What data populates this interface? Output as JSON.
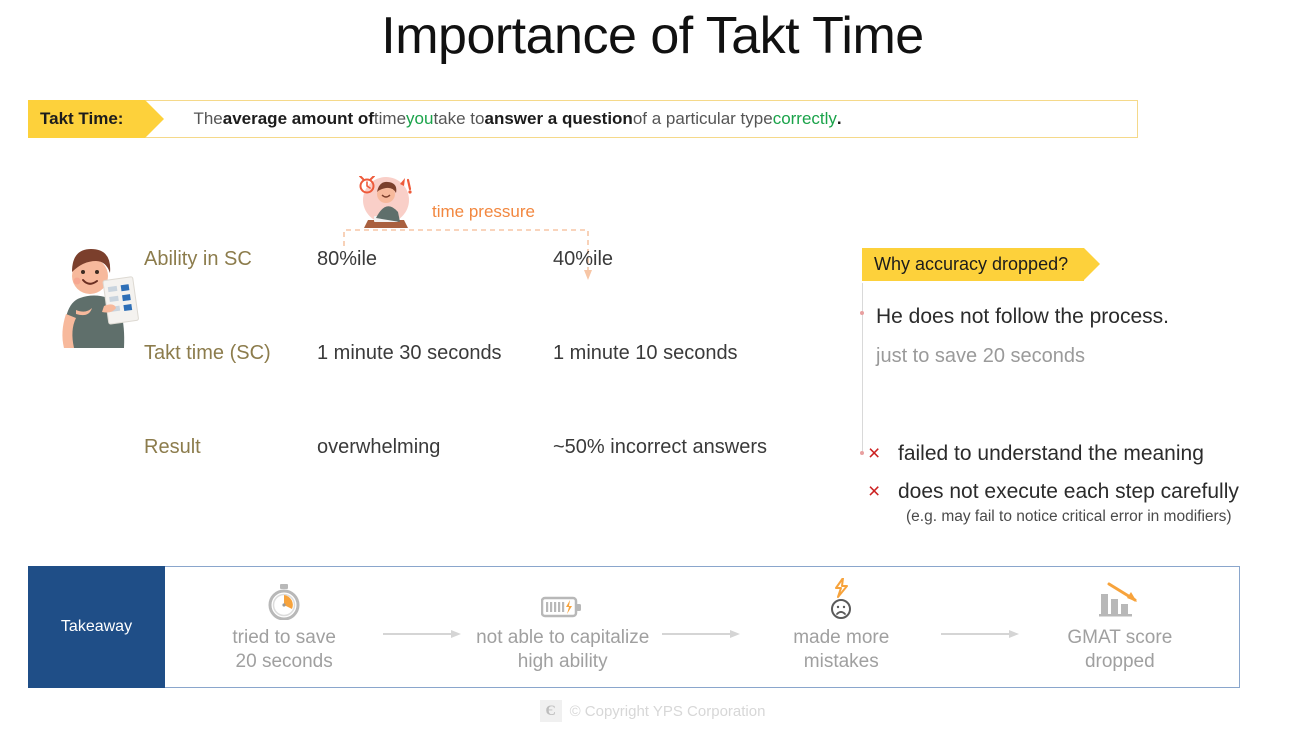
{
  "title": "Importance of Takt Time",
  "definition": {
    "tag": "Takt Time:",
    "seg1": "The ",
    "seg2_bold": "average amount of",
    "seg3": " time ",
    "seg4_green": "you",
    "seg5": " take to ",
    "seg6_bold": "answer a question",
    "seg7": " of a particular type ",
    "seg8_green": "correctly",
    "seg9": "."
  },
  "time_pressure": {
    "label": "time pressure"
  },
  "comparison": {
    "rows": [
      {
        "label": "Ability in SC",
        "col1": "80%ile",
        "col2": "40%ile"
      },
      {
        "label": "Takt time (SC)",
        "col1": "1 minute 30 seconds",
        "col2": "1 minute 10 seconds"
      },
      {
        "label": "Result",
        "col1": "overwhelming",
        "col2": "~50% incorrect answers"
      }
    ]
  },
  "why": {
    "tag": "Why accuracy dropped?",
    "line1": "He does not follow the process.",
    "line2": "just to save 20 seconds",
    "x_mark": "×",
    "reason1": "failed to understand the meaning",
    "reason2": "does not execute each step carefully",
    "note": "(e.g. may fail to notice critical error in modifiers)"
  },
  "takeaway": {
    "tag": "Takeaway",
    "arrow": "→",
    "steps": [
      {
        "icon": "stopwatch-icon",
        "line1": "tried to save",
        "line2": "20 seconds"
      },
      {
        "icon": "battery-icon",
        "line1": "not able to capitalize",
        "line2": "high ability"
      },
      {
        "icon": "sad-face-icon",
        "line1": "made more",
        "line2": "mistakes"
      },
      {
        "icon": "bar-chart-down-icon",
        "line1": "GMAT score",
        "line2": "dropped"
      }
    ]
  },
  "footer": {
    "logo_glyph": "Є",
    "text": "© Copyright YPS Corporation"
  },
  "colors": {
    "yellow": "#fdd13b",
    "green": "#1aa34a",
    "olive": "#8c7c4c",
    "orange": "#f2873f",
    "red": "#cc2222",
    "blue": "#1f4e87",
    "grey": "#a0a0a0"
  }
}
